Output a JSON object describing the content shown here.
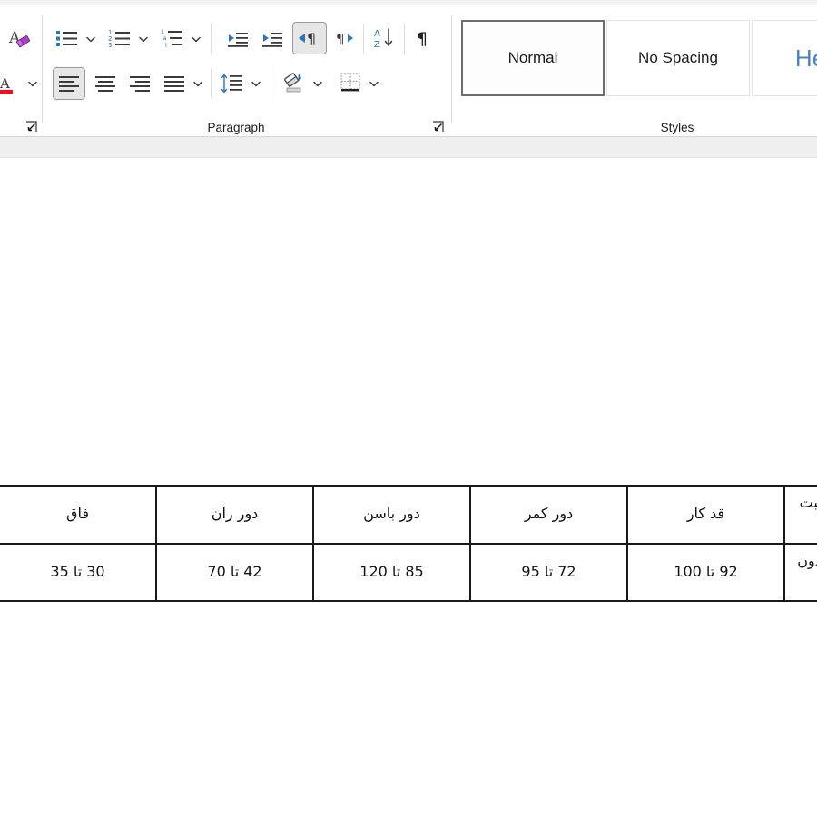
{
  "app": {
    "kind": "word-processor-ribbon"
  },
  "ribbon": {
    "groups": [
      {
        "name": "font",
        "label": ""
      },
      {
        "name": "paragraph",
        "label": "Paragraph"
      },
      {
        "name": "styles",
        "label": "Styles"
      }
    ],
    "font_group": {
      "clear_formatting_tooltip": "Clear All Formatting",
      "font_color_tooltip": "Font Color",
      "font_color_hex": "#e81123",
      "clear_formatting_icon": "clear-formatting-icon",
      "font_color_icon": "font-color-icon"
    },
    "paragraph_group": {
      "label": "Paragraph",
      "dialog_launcher_left": "paragraph-dialog-launcher-left",
      "dialog_launcher_right": "paragraph-dialog-launcher-right",
      "row1": [
        {
          "name": "bullets",
          "icon": "bulleted-list-icon",
          "tooltip": "Bullets",
          "has_dropdown": true,
          "active": false
        },
        {
          "name": "numbering",
          "icon": "numbered-list-icon",
          "tooltip": "Numbering",
          "has_dropdown": true,
          "active": false
        },
        {
          "name": "multilevel-list",
          "icon": "multilevel-list-icon",
          "tooltip": "Multilevel List",
          "has_dropdown": true,
          "active": false
        },
        {
          "name": "decrease-indent",
          "icon": "decrease-indent-icon",
          "tooltip": "Decrease Indent",
          "has_dropdown": false,
          "active": false
        },
        {
          "name": "increase-indent",
          "icon": "increase-indent-icon",
          "tooltip": "Increase Indent",
          "has_dropdown": false,
          "active": false
        },
        {
          "name": "rtl-text-direction",
          "icon": "right-to-left-text-direction-icon",
          "tooltip": "Right-to-Left Text Direction",
          "has_dropdown": false,
          "active": true
        },
        {
          "name": "ltr-text-direction",
          "icon": "left-to-right-text-direction-icon",
          "tooltip": "Left-to-Right Text Direction",
          "has_dropdown": false,
          "active": false
        },
        {
          "name": "sort",
          "icon": "sort-a-z-icon",
          "tooltip": "Sort",
          "has_dropdown": false,
          "active": false
        },
        {
          "name": "show-formatting-marks",
          "icon": "pilcrow-icon",
          "tooltip": "Show/Hide Formatting Marks",
          "has_dropdown": false,
          "active": false
        }
      ],
      "row2": [
        {
          "name": "align-left",
          "icon": "align-left-icon",
          "tooltip": "Align Left",
          "has_dropdown": false,
          "active": true
        },
        {
          "name": "align-center",
          "icon": "align-center-icon",
          "tooltip": "Center",
          "has_dropdown": false,
          "active": false
        },
        {
          "name": "align-right",
          "icon": "align-right-icon",
          "tooltip": "Align Right",
          "has_dropdown": false,
          "active": false
        },
        {
          "name": "justify",
          "icon": "justify-icon",
          "tooltip": "Justify",
          "has_dropdown": true,
          "active": false
        },
        {
          "name": "line-spacing",
          "icon": "line-and-paragraph-spacing-icon",
          "tooltip": "Line and Paragraph Spacing",
          "has_dropdown": true,
          "active": false
        },
        {
          "name": "shading",
          "icon": "shading-paint-bucket-icon",
          "tooltip": "Shading",
          "has_dropdown": true,
          "active": false
        },
        {
          "name": "borders",
          "icon": "borders-icon",
          "tooltip": "Borders",
          "has_dropdown": true,
          "active": false
        }
      ]
    },
    "styles_group": {
      "label": "Styles",
      "cards": [
        {
          "name": "style-normal",
          "label": "Normal",
          "selected": true,
          "style_class": "label-normal"
        },
        {
          "name": "style-no-spacing",
          "label": "No Spacing",
          "selected": false,
          "style_class": "label-nospacing"
        },
        {
          "name": "style-heading-1",
          "label": "Head",
          "selected": false,
          "style_class": "label-heading"
        }
      ],
      "heading_color_hex": "#4a82c4"
    }
  },
  "document": {
    "language": "fa",
    "direction": "rtl",
    "table": {
      "name": "size-chart-table",
      "header_row": [
        "اندازه ها به نسبت سایز",
        "قد کار",
        "دور کمر",
        "دور باسن",
        "دور ران",
        "فاق"
      ],
      "body_rows": [
        [
          "با کشسانی و بدون کشسانی",
          "92 تا 100",
          "72 تا 95",
          "85 تا 120",
          "42 تا 70",
          "30 تا 35"
        ]
      ]
    }
  }
}
